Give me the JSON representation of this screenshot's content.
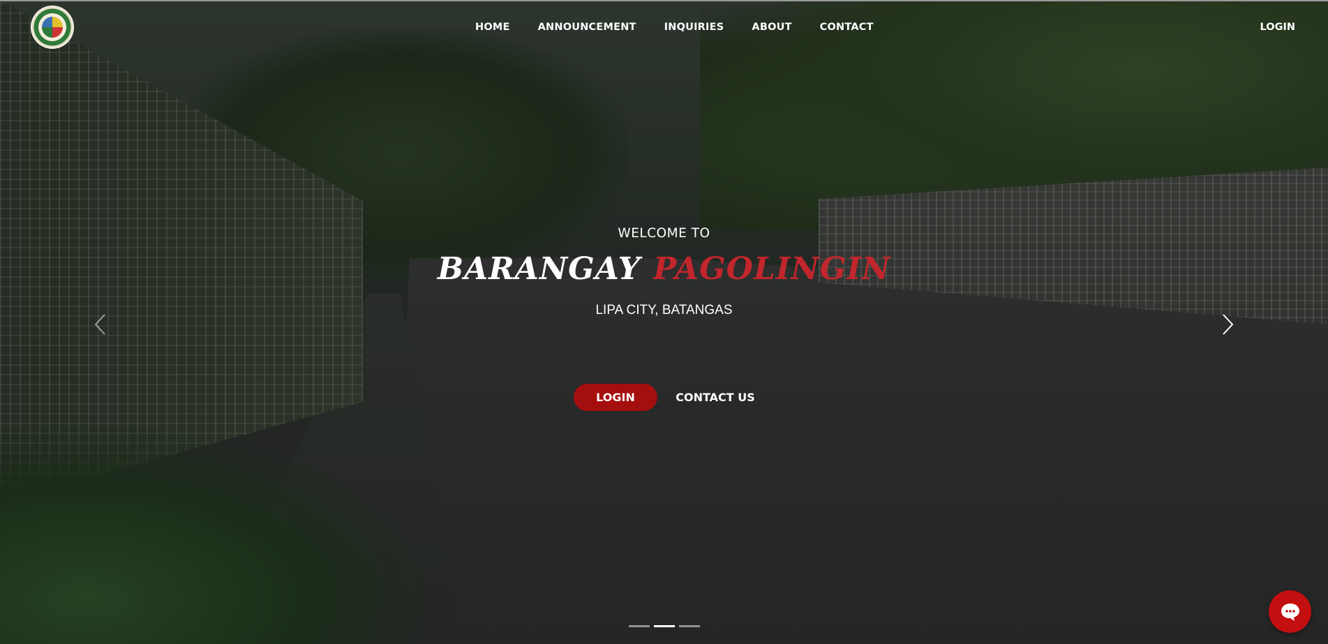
{
  "nav": {
    "logo_icon": "barangay-seal-logo",
    "items": [
      {
        "label": "HOME"
      },
      {
        "label": "ANNOUNCEMENT"
      },
      {
        "label": "INQUIRIES"
      },
      {
        "label": "ABOUT"
      },
      {
        "label": "CONTACT"
      }
    ],
    "login": "LOGIN"
  },
  "hero": {
    "welcome": "WELCOME TO",
    "title_part1": "BARANGAY",
    "title_part2": "PAGOLINGIN",
    "location": "LIPA CITY, BATANGAS",
    "login_button": "LOGIN",
    "contact_button": "CONTACT US"
  },
  "carousel": {
    "prev_icon": "chevron-left-icon",
    "next_icon": "chevron-right-icon",
    "slide_count": 3,
    "active_slide": 2
  },
  "chat_widget": {
    "icon": "chat-bubble-icon"
  },
  "colors": {
    "accent_red": "#a50e0e",
    "title_red": "#c2262d",
    "chat_red": "#c30f0f"
  }
}
